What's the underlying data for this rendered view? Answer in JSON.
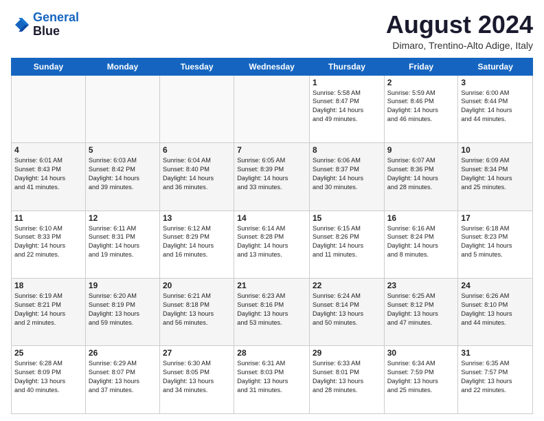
{
  "logo": {
    "line1": "General",
    "line2": "Blue"
  },
  "title": "August 2024",
  "location": "Dimaro, Trentino-Alto Adige, Italy",
  "days_of_week": [
    "Sunday",
    "Monday",
    "Tuesday",
    "Wednesday",
    "Thursday",
    "Friday",
    "Saturday"
  ],
  "weeks": [
    [
      {
        "day": "",
        "info": ""
      },
      {
        "day": "",
        "info": ""
      },
      {
        "day": "",
        "info": ""
      },
      {
        "day": "",
        "info": ""
      },
      {
        "day": "1",
        "info": "Sunrise: 5:58 AM\nSunset: 8:47 PM\nDaylight: 14 hours\nand 49 minutes."
      },
      {
        "day": "2",
        "info": "Sunrise: 5:59 AM\nSunset: 8:46 PM\nDaylight: 14 hours\nand 46 minutes."
      },
      {
        "day": "3",
        "info": "Sunrise: 6:00 AM\nSunset: 8:44 PM\nDaylight: 14 hours\nand 44 minutes."
      }
    ],
    [
      {
        "day": "4",
        "info": "Sunrise: 6:01 AM\nSunset: 8:43 PM\nDaylight: 14 hours\nand 41 minutes."
      },
      {
        "day": "5",
        "info": "Sunrise: 6:03 AM\nSunset: 8:42 PM\nDaylight: 14 hours\nand 39 minutes."
      },
      {
        "day": "6",
        "info": "Sunrise: 6:04 AM\nSunset: 8:40 PM\nDaylight: 14 hours\nand 36 minutes."
      },
      {
        "day": "7",
        "info": "Sunrise: 6:05 AM\nSunset: 8:39 PM\nDaylight: 14 hours\nand 33 minutes."
      },
      {
        "day": "8",
        "info": "Sunrise: 6:06 AM\nSunset: 8:37 PM\nDaylight: 14 hours\nand 30 minutes."
      },
      {
        "day": "9",
        "info": "Sunrise: 6:07 AM\nSunset: 8:36 PM\nDaylight: 14 hours\nand 28 minutes."
      },
      {
        "day": "10",
        "info": "Sunrise: 6:09 AM\nSunset: 8:34 PM\nDaylight: 14 hours\nand 25 minutes."
      }
    ],
    [
      {
        "day": "11",
        "info": "Sunrise: 6:10 AM\nSunset: 8:33 PM\nDaylight: 14 hours\nand 22 minutes."
      },
      {
        "day": "12",
        "info": "Sunrise: 6:11 AM\nSunset: 8:31 PM\nDaylight: 14 hours\nand 19 minutes."
      },
      {
        "day": "13",
        "info": "Sunrise: 6:12 AM\nSunset: 8:29 PM\nDaylight: 14 hours\nand 16 minutes."
      },
      {
        "day": "14",
        "info": "Sunrise: 6:14 AM\nSunset: 8:28 PM\nDaylight: 14 hours\nand 13 minutes."
      },
      {
        "day": "15",
        "info": "Sunrise: 6:15 AM\nSunset: 8:26 PM\nDaylight: 14 hours\nand 11 minutes."
      },
      {
        "day": "16",
        "info": "Sunrise: 6:16 AM\nSunset: 8:24 PM\nDaylight: 14 hours\nand 8 minutes."
      },
      {
        "day": "17",
        "info": "Sunrise: 6:18 AM\nSunset: 8:23 PM\nDaylight: 14 hours\nand 5 minutes."
      }
    ],
    [
      {
        "day": "18",
        "info": "Sunrise: 6:19 AM\nSunset: 8:21 PM\nDaylight: 14 hours\nand 2 minutes."
      },
      {
        "day": "19",
        "info": "Sunrise: 6:20 AM\nSunset: 8:19 PM\nDaylight: 13 hours\nand 59 minutes."
      },
      {
        "day": "20",
        "info": "Sunrise: 6:21 AM\nSunset: 8:18 PM\nDaylight: 13 hours\nand 56 minutes."
      },
      {
        "day": "21",
        "info": "Sunrise: 6:23 AM\nSunset: 8:16 PM\nDaylight: 13 hours\nand 53 minutes."
      },
      {
        "day": "22",
        "info": "Sunrise: 6:24 AM\nSunset: 8:14 PM\nDaylight: 13 hours\nand 50 minutes."
      },
      {
        "day": "23",
        "info": "Sunrise: 6:25 AM\nSunset: 8:12 PM\nDaylight: 13 hours\nand 47 minutes."
      },
      {
        "day": "24",
        "info": "Sunrise: 6:26 AM\nSunset: 8:10 PM\nDaylight: 13 hours\nand 44 minutes."
      }
    ],
    [
      {
        "day": "25",
        "info": "Sunrise: 6:28 AM\nSunset: 8:09 PM\nDaylight: 13 hours\nand 40 minutes."
      },
      {
        "day": "26",
        "info": "Sunrise: 6:29 AM\nSunset: 8:07 PM\nDaylight: 13 hours\nand 37 minutes."
      },
      {
        "day": "27",
        "info": "Sunrise: 6:30 AM\nSunset: 8:05 PM\nDaylight: 13 hours\nand 34 minutes."
      },
      {
        "day": "28",
        "info": "Sunrise: 6:31 AM\nSunset: 8:03 PM\nDaylight: 13 hours\nand 31 minutes."
      },
      {
        "day": "29",
        "info": "Sunrise: 6:33 AM\nSunset: 8:01 PM\nDaylight: 13 hours\nand 28 minutes."
      },
      {
        "day": "30",
        "info": "Sunrise: 6:34 AM\nSunset: 7:59 PM\nDaylight: 13 hours\nand 25 minutes."
      },
      {
        "day": "31",
        "info": "Sunrise: 6:35 AM\nSunset: 7:57 PM\nDaylight: 13 hours\nand 22 minutes."
      }
    ]
  ]
}
